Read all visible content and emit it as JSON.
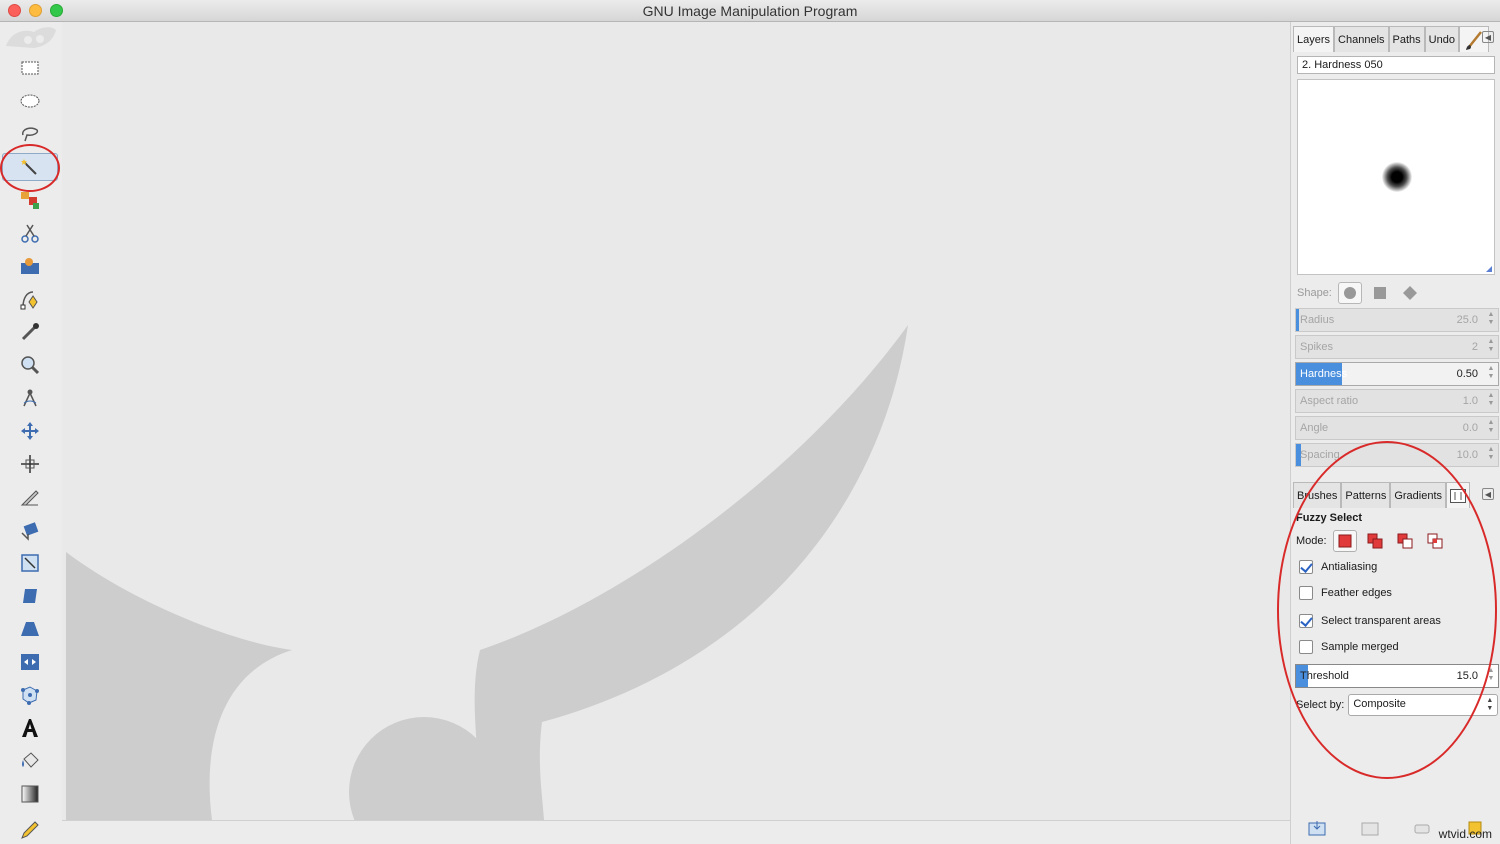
{
  "window": {
    "title": "GNU Image Manipulation Program"
  },
  "toolbox": {
    "tools": [
      {
        "name": "rect-select-tool",
        "icon": "rect-select-icon"
      },
      {
        "name": "ellipse-select-tool",
        "icon": "ellipse-select-icon"
      },
      {
        "name": "free-select-tool",
        "icon": "lasso-icon"
      },
      {
        "name": "fuzzy-select-tool",
        "icon": "magic-wand-icon",
        "active": true
      },
      {
        "name": "color-select-tool",
        "icon": "color-select-icon"
      },
      {
        "name": "scissors-select-tool",
        "icon": "scissors-icon"
      },
      {
        "name": "foreground-select-tool",
        "icon": "foreground-select-icon"
      },
      {
        "name": "paths-tool",
        "icon": "paths-icon"
      },
      {
        "name": "color-picker-tool",
        "icon": "eyedropper-icon"
      },
      {
        "name": "zoom-tool",
        "icon": "magnifier-icon"
      },
      {
        "name": "measure-tool",
        "icon": "compass-icon"
      },
      {
        "name": "move-tool",
        "icon": "move-icon"
      },
      {
        "name": "align-tool",
        "icon": "align-icon"
      },
      {
        "name": "crop-tool",
        "icon": "knife-icon"
      },
      {
        "name": "rotate-tool",
        "icon": "rotate-icon"
      },
      {
        "name": "scale-tool",
        "icon": "scale-icon"
      },
      {
        "name": "shear-tool",
        "icon": "shear-icon"
      },
      {
        "name": "perspective-tool",
        "icon": "perspective-icon"
      },
      {
        "name": "flip-tool",
        "icon": "flip-icon"
      },
      {
        "name": "cage-transform-tool",
        "icon": "cage-icon"
      },
      {
        "name": "text-tool",
        "icon": "text-icon"
      },
      {
        "name": "bucket-fill-tool",
        "icon": "bucket-icon"
      },
      {
        "name": "blend-tool",
        "icon": "gradient-icon"
      },
      {
        "name": "pencil-tool",
        "icon": "pencil-icon"
      }
    ]
  },
  "top_dock": {
    "tabs": [
      "Layers",
      "Channels",
      "Paths",
      "Undo"
    ],
    "brush_name": "2. Hardness 050",
    "shape_label": "Shape:",
    "sliders": [
      {
        "label": "Radius",
        "value": "25.0",
        "fill": 0.03
      },
      {
        "label": "Spikes",
        "value": "2",
        "fill": 0
      },
      {
        "label": "Hardness",
        "value": "0.50",
        "fill": 0.5,
        "highlight": true
      },
      {
        "label": "Aspect ratio",
        "value": "1.0",
        "fill": 0
      },
      {
        "label": "Angle",
        "value": "0.0",
        "fill": 0
      },
      {
        "label": "Spacing",
        "value": "10.0",
        "fill": 0.05
      }
    ]
  },
  "bottom_dock": {
    "tabs": [
      "Brushes",
      "Patterns",
      "Gradients"
    ],
    "tool_title": "Fuzzy Select",
    "mode_label": "Mode:",
    "options": [
      {
        "label": "Antialiasing",
        "checked": true
      },
      {
        "label": "Feather edges",
        "checked": false
      },
      {
        "label": "Select transparent areas",
        "checked": true
      },
      {
        "label": "Sample merged",
        "checked": false
      }
    ],
    "threshold": {
      "label": "Threshold",
      "value": "15.0",
      "fill": 0.06
    },
    "select_by_label": "Select by:",
    "select_by_value": "Composite"
  },
  "watermark": "wtvid.com",
  "colors": {
    "annotation_red": "#d92a2a",
    "accent_blue": "#4a8fde",
    "canvas_shape": "#cdcdcd"
  }
}
